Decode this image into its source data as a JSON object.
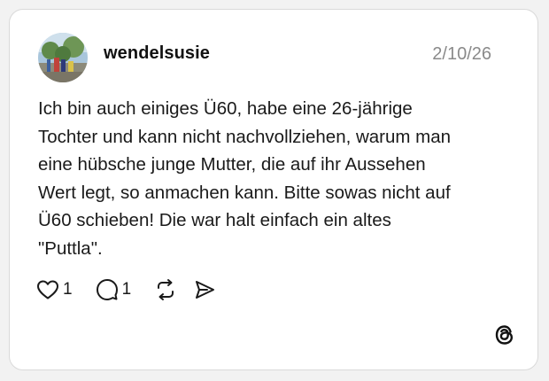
{
  "post": {
    "username": "wendelsusie",
    "date": "2/10/26",
    "text": "Ich bin auch einiges Ü60, habe eine 26-jährige\nTochter und kann nicht nachvollziehen, warum man\neine hübsche junge Mutter, die auf ihr Aussehen\nWert legt, so anmachen kann. Bitte sowas nicht auf\nÜ60 schieben! Die war halt einfach ein altes\n\"Puttla\".",
    "avatar_icon": "avatar-photo"
  },
  "actions": {
    "like_icon": "heart-icon",
    "like_count": "1",
    "reply_icon": "comment-icon",
    "reply_count": "1",
    "repost_icon": "repost-icon",
    "share_icon": "send-icon"
  },
  "brand": {
    "logo_icon": "threads-logo-icon"
  },
  "colors": {
    "background": "#f2f2f2",
    "card": "#ffffff",
    "text": "#1a1a1a",
    "muted": "#8a8a8a"
  }
}
